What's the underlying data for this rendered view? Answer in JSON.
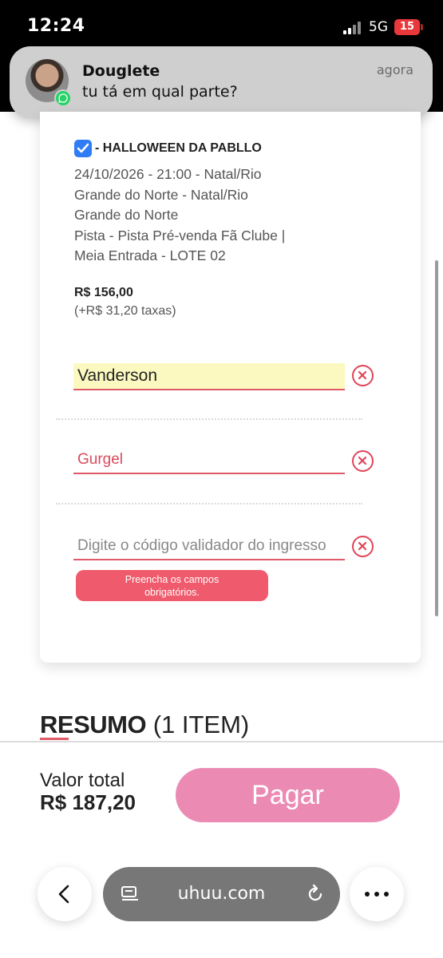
{
  "status_bar": {
    "time": "12:24",
    "network": "5G",
    "battery": "15"
  },
  "notification": {
    "sender": "Douglete",
    "message": "tu tá em qual parte?",
    "time": "agora",
    "app_icon": "whatsapp-icon"
  },
  "ticket": {
    "title": "- HALLOWEEN DA PABLLO",
    "details": [
      "24/10/2026 - 21:00 - Natal/Rio",
      "Grande do Norte - Natal/Rio",
      "Grande do Norte",
      "Pista - Pista Pré-venda Fã Clube |",
      "Meia Entrada - LOTE 02"
    ],
    "price": "R$ 156,00",
    "fees": "(+R$ 31,20 taxas)",
    "checked": true
  },
  "form": {
    "first_name": "Vanderson",
    "last_name": "Gurgel",
    "code_placeholder": "Digite o código validador do ingresso",
    "error_line1": "Preencha os campos",
    "error_line2": "obrigatórios."
  },
  "summary": {
    "title_bold": "RESUMO",
    "title_rest": "(1 ITEM)"
  },
  "checkout": {
    "total_label": "Valor total",
    "total_value": "R$ 187,20",
    "pay_label": "Pagar",
    "accent": "#eb8bb4"
  },
  "browser": {
    "url": "uhuu.com"
  },
  "colors": {
    "error": "#ef5a6c",
    "checkbox": "#2f7cf6",
    "highlight": "#fbf9c0"
  }
}
